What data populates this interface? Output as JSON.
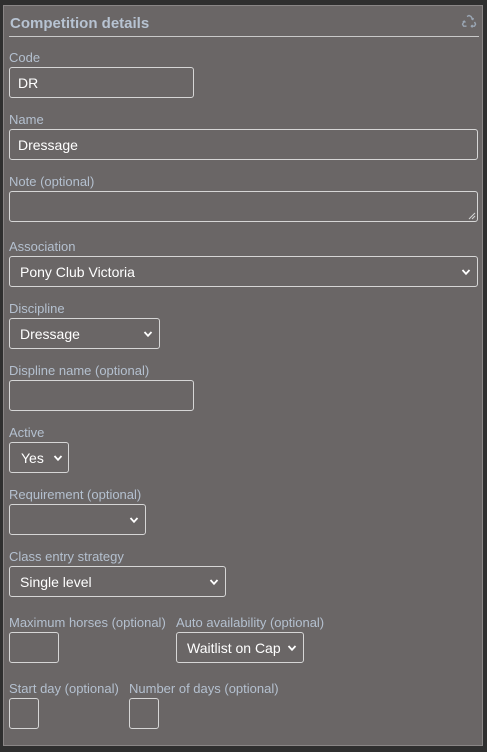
{
  "panel": {
    "title": "Competition details",
    "icon": "recycle-icon"
  },
  "fields": {
    "code": {
      "label": "Code",
      "value": "DR"
    },
    "name": {
      "label": "Name",
      "value": "Dressage"
    },
    "note": {
      "label": "Note (optional)",
      "value": ""
    },
    "association": {
      "label": "Association",
      "selected": "Pony Club Victoria"
    },
    "discipline": {
      "label": "Discipline",
      "selected": "Dressage"
    },
    "discipline_name": {
      "label": "Displine name (optional)",
      "value": ""
    },
    "active": {
      "label": "Active",
      "selected": "Yes"
    },
    "requirement": {
      "label": "Requirement (optional)",
      "selected": ""
    },
    "class_entry_strategy": {
      "label": "Class entry strategy",
      "selected": "Single level"
    },
    "maximum_horses": {
      "label": "Maximum horses (optional)",
      "value": ""
    },
    "auto_availability": {
      "label": "Auto availability (optional)",
      "selected": "Waitlist on Cap"
    },
    "start_day": {
      "label": "Start day (optional)",
      "value": ""
    },
    "number_of_days": {
      "label": "Number of days (optional)",
      "value": ""
    }
  },
  "colors": {
    "panel_bg": "#6a6666",
    "label": "#b4c0cf",
    "title": "#b7c3d2",
    "border": "#d6d6d6",
    "text": "#ffffff"
  }
}
